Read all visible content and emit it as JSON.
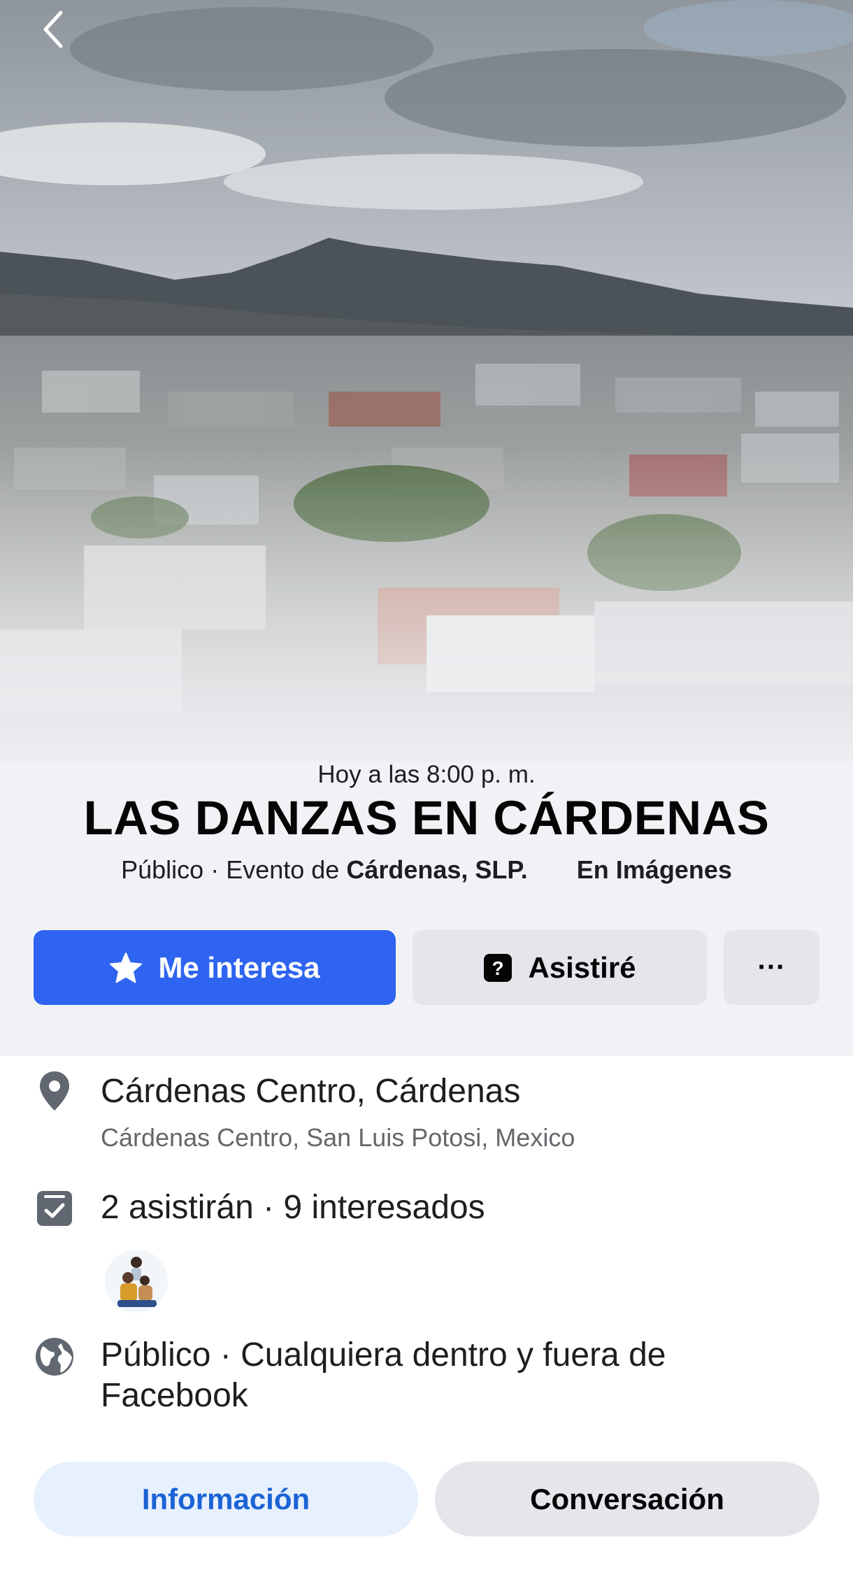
{
  "navigation": {
    "back_icon": "chevron-left-icon"
  },
  "event": {
    "datetime": "Hoy a las 8:00 p. m.",
    "title": "LAS DANZAS EN CÁRDENAS",
    "privacy_prefix": "Público · Evento de ",
    "host": "Cárdenas, SLP.",
    "co_host": "En Imágenes"
  },
  "actions": {
    "interested_label": "Me interesa",
    "interested_icon": "star-icon",
    "going_label": "Asistiré",
    "going_icon": "question-square-icon",
    "more_label": "···"
  },
  "details": {
    "location_name": "Cárdenas Centro, Cárdenas",
    "location_address": "Cárdenas Centro, San Luis Potosi, Mexico",
    "attendance": "2 asistirán · 9 interesados",
    "privacy_text_line1": "Público · Cualquiera dentro y fuera de",
    "privacy_text_line2": "Facebook"
  },
  "tabs": [
    {
      "label": "Información",
      "active": true
    },
    {
      "label": "Conversación",
      "active": false
    }
  ],
  "colors": {
    "primary": "#2e64f0",
    "secondary_button": "#e4e6eb",
    "tab_active_bg": "#e7f0fd",
    "tab_active_text": "#1b63d6",
    "header_bg": "#f1f2f5"
  }
}
